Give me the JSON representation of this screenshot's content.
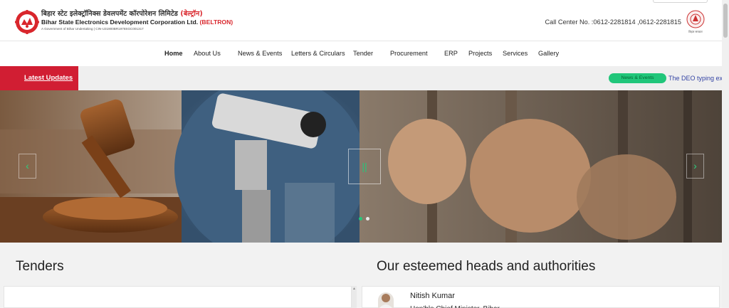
{
  "header": {
    "brand_hindi": "बिहार स्टेट इलेक्ट्रॉनिक्स डेवलपमेंट कॉरपोरेशन लिमिटेड",
    "brand_hindi_short": "(बेल्ट्रॉन)",
    "brand_english": "Bihar State Electronics Development Corporation Ltd.",
    "brand_english_short": "(BELTRON)",
    "brand_subtitle": "A Government of Bihar Undertaking  |  CIN-U31900BR1978SGC001317",
    "call_center": "Call Center No. :0612-2281814 ,0612-2281815",
    "emblem_caption": "बिहार सरकार"
  },
  "nav": {
    "items": [
      {
        "label": "Home",
        "active": true
      },
      {
        "label": "About Us"
      },
      {
        "label": "News & Events"
      },
      {
        "label": "Letters & Circulars"
      },
      {
        "label": "Tender"
      },
      {
        "label": "Procurement"
      },
      {
        "label": "ERP"
      },
      {
        "label": "Projects"
      },
      {
        "label": "Services"
      },
      {
        "label": "Gallery"
      }
    ]
  },
  "updates": {
    "label": "Latest Updates",
    "badge": "News & Events",
    "ticker_text": "The DEO typing exam"
  },
  "slider": {
    "prev_icon": "‹",
    "next_icon": "›",
    "pause_icon": "||"
  },
  "sections": {
    "tenders_title": "Tenders",
    "authorities_title": "Our esteemed heads and authorities"
  },
  "authorities": [
    {
      "name": "Nitish Kumar",
      "role": "Hon'ble Chief Minister, Bihar"
    }
  ],
  "colors": {
    "accent_red": "#d11e33",
    "accent_green": "#21c67a",
    "link_blue": "#3444a4"
  }
}
